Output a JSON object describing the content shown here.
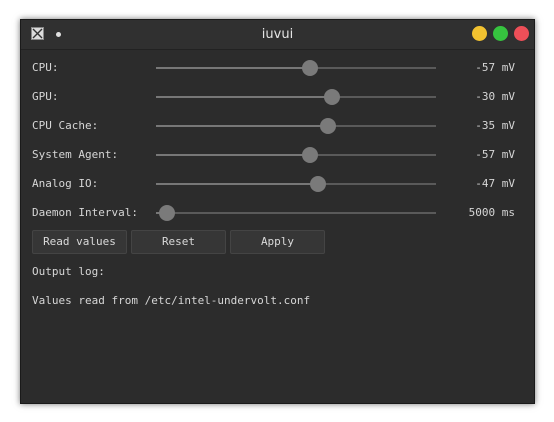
{
  "window": {
    "title": "iuvui"
  },
  "sliders": [
    {
      "label": "CPU:",
      "value_text": "-57 mV",
      "level": 0.55
    },
    {
      "label": "GPU:",
      "value_text": "-30 mV",
      "level": 0.63
    },
    {
      "label": "CPU Cache:",
      "value_text": "-35 mV",
      "level": 0.615
    },
    {
      "label": "System Agent:",
      "value_text": "-57 mV",
      "level": 0.55
    },
    {
      "label": "Analog IO:",
      "value_text": "-47 mV",
      "level": 0.58
    },
    {
      "label": "Daemon Interval:",
      "value_text": "5000 ms",
      "level": 0.04
    }
  ],
  "buttons": {
    "read_values": "Read values",
    "reset": "Reset",
    "apply": "Apply"
  },
  "output": {
    "label": "Output log:",
    "message": "Values read from /etc/intel-undervolt.conf"
  },
  "colors": {
    "minimize": "#f2c230",
    "maximize": "#36c43f",
    "close": "#ee4f58",
    "background": "#2c2c2c"
  }
}
